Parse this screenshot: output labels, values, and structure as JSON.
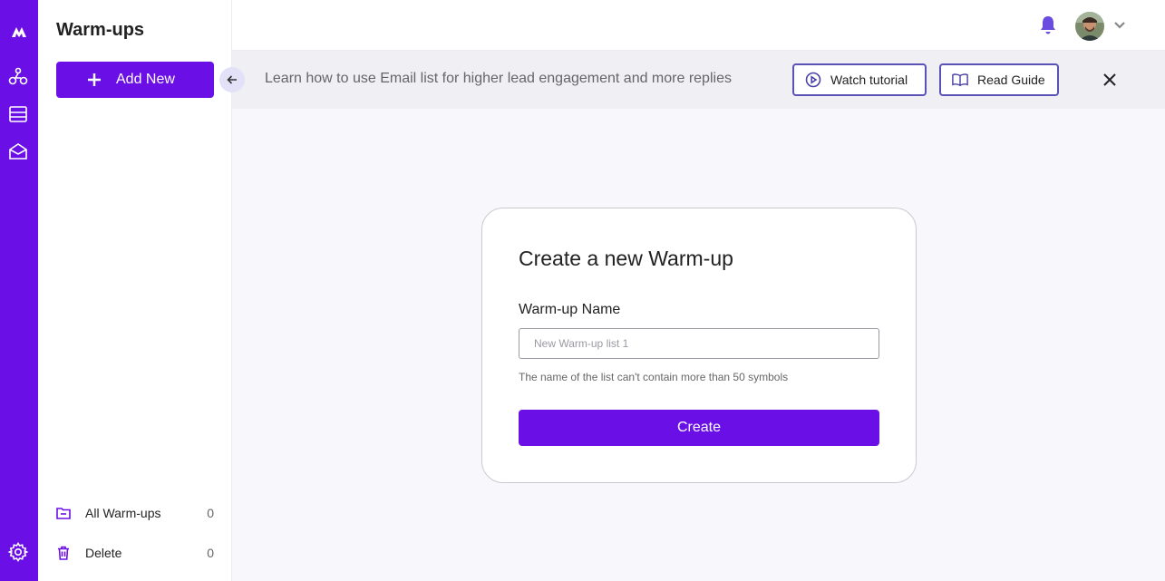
{
  "colors": {
    "accent": "#6a0fe6",
    "rail": "#6a0fe6",
    "outline": "#5b52b6",
    "banner_bg": "#efeff4",
    "page_bg": "#f7f7fc"
  },
  "rail": {
    "icons": [
      "logo-icon",
      "warmup-people-icon",
      "list-icon",
      "mailbox-icon",
      "settings-icon"
    ]
  },
  "sidebar": {
    "title": "Warm-ups",
    "add_button": "Add New",
    "items": [
      {
        "label": "All Warm-ups",
        "count": "0",
        "icon": "folder-icon"
      },
      {
        "label": "Delete",
        "count": "0",
        "icon": "trash-icon"
      }
    ]
  },
  "topbar": {
    "icons": [
      "bell-icon",
      "avatar",
      "chevron-down-icon"
    ]
  },
  "banner": {
    "text": "Learn how to use Email list for higher lead engagement and more replies",
    "watch_label": "Watch tutorial",
    "guide_label": "Read Guide"
  },
  "card": {
    "title": "Create a new Warm-up",
    "field_label": "Warm-up Name",
    "placeholder": "New Warm-up list 1",
    "value": "",
    "hint": "The name of the list can't contain more than 50 symbols",
    "submit_label": "Create"
  }
}
